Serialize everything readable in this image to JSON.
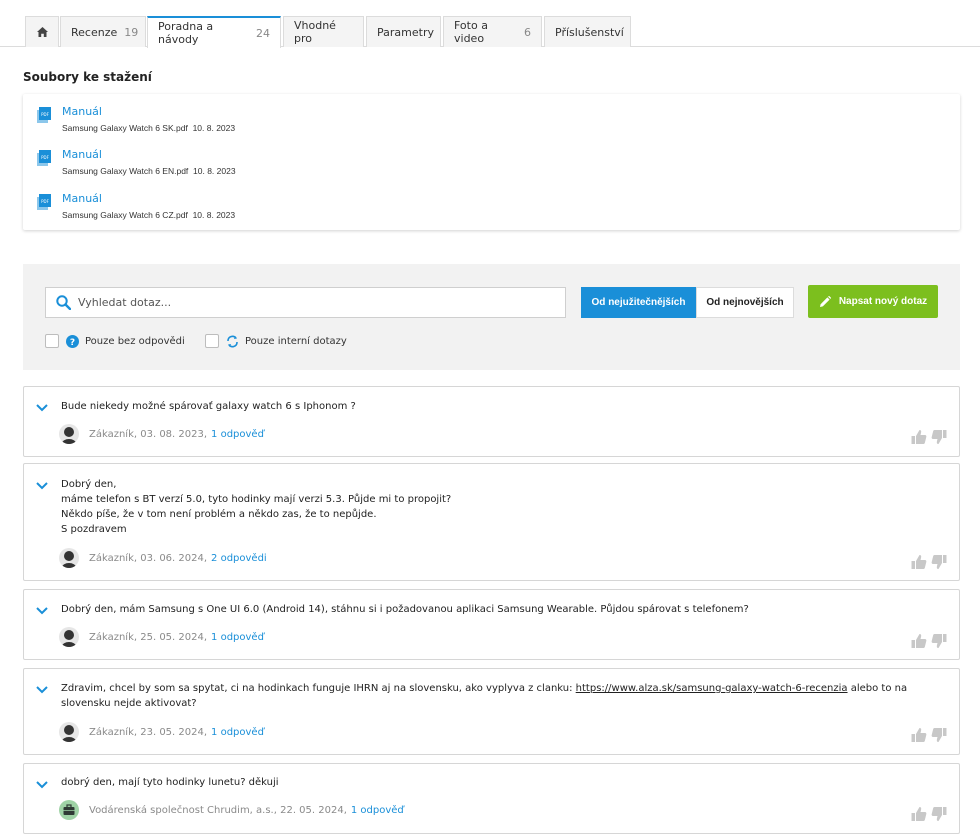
{
  "tabs": [
    {
      "label": "",
      "count": "",
      "icon": "home-icon"
    },
    {
      "label": "Recenze",
      "count": "19"
    },
    {
      "label": "Poradna a návody",
      "count": "24"
    },
    {
      "label": "Vhodné pro",
      "count": ""
    },
    {
      "label": "Parametry",
      "count": ""
    },
    {
      "label": "Foto a video",
      "count": "6"
    },
    {
      "label": "Příslušenství",
      "count": ""
    }
  ],
  "downloads": {
    "title": "Soubory ke stažení",
    "items": [
      {
        "title": "Manuál",
        "file": "Samsung Galaxy Watch 6 SK.pdf",
        "date": "10. 8. 2023"
      },
      {
        "title": "Manuál",
        "file": "Samsung Galaxy Watch 6 EN.pdf",
        "date": "10. 8. 2023"
      },
      {
        "title": "Manuál",
        "file": "Samsung Galaxy Watch 6 CZ.pdf",
        "date": "10. 8. 2023"
      }
    ]
  },
  "search": {
    "placeholder": "Vyhledat dotaz...",
    "sort_useful": "Od nejužitečnějších",
    "sort_newest": "Od nejnovějších",
    "new_question": "Napsat nový dotaz",
    "filter_unanswered": "Pouze bez odpovědi",
    "filter_internal": "Pouze interní dotazy"
  },
  "questions": [
    {
      "lines": [
        "Bude niekedy možné spárovať galaxy watch 6 s Iphonom ?"
      ],
      "author": "Zákazník, 03. 08. 2023,",
      "answers": "1 odpověď"
    },
    {
      "lines": [
        "Dobrý den,",
        "máme telefon s BT verzí 5.0, tyto hodinky mají verzi 5.3. Půjde mi to propojit?",
        "Někdo píše, že v tom není problém a někdo zas, že to nepůjde.",
        "S pozdravem"
      ],
      "author": "Zákazník, 03. 06. 2024,",
      "answers": "2 odpovědi"
    },
    {
      "lines": [
        "Dobrý den, mám Samsung s One UI 6.0 (Android 14), stáhnu si i požadovanou aplikaci Samsung Wearable. Půjdou spárovat s telefonem?"
      ],
      "author": "Zákazník, 25. 05. 2024,",
      "answers": "1 odpověď"
    },
    {
      "text_before": "Zdravim, chcel by som sa spytat, ci na hodinkach funguje IHRN aj na slovensku, ako vyplyva z clanku: ",
      "link": "https://www.alza.sk/samsung-galaxy-watch-6-recenzia",
      "text_after": " alebo to na slovensku nejde aktivovat?",
      "author": "Zákazník, 23. 05. 2024,",
      "answers": "1 odpověď"
    },
    {
      "lines": [
        "dobrý den, mají tyto hodinky lunetu? děkuji"
      ],
      "author": "Vodárenská společnost Chrudim, a.s., 22. 05. 2024,",
      "answers": "1 odpověď"
    }
  ],
  "colors": {
    "accent": "#1a8fd8",
    "green": "#7cbf1e"
  }
}
